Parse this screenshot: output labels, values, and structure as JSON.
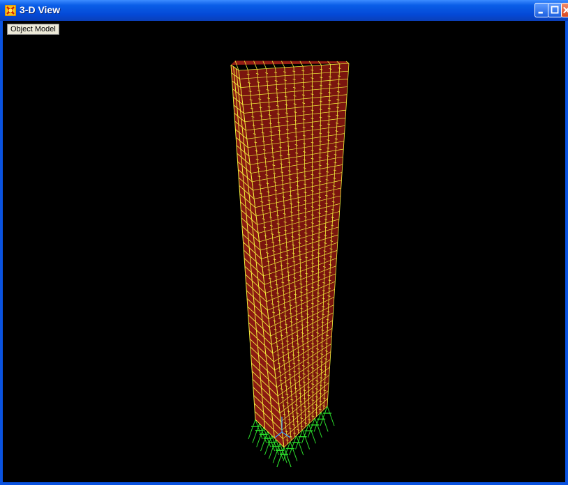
{
  "window": {
    "title": "3-D View",
    "icon": "structure-app-icon",
    "controls": {
      "minimize": "minimize-icon",
      "maximize": "maximize-icon",
      "close": "close-icon"
    }
  },
  "viewport": {
    "label": "Object Model",
    "background": "#000000",
    "colors": {
      "slab": "#8b1a12",
      "frame": "#f2ee3c",
      "support": "#2bdc2b",
      "axis": "#3aa0ff"
    }
  }
}
